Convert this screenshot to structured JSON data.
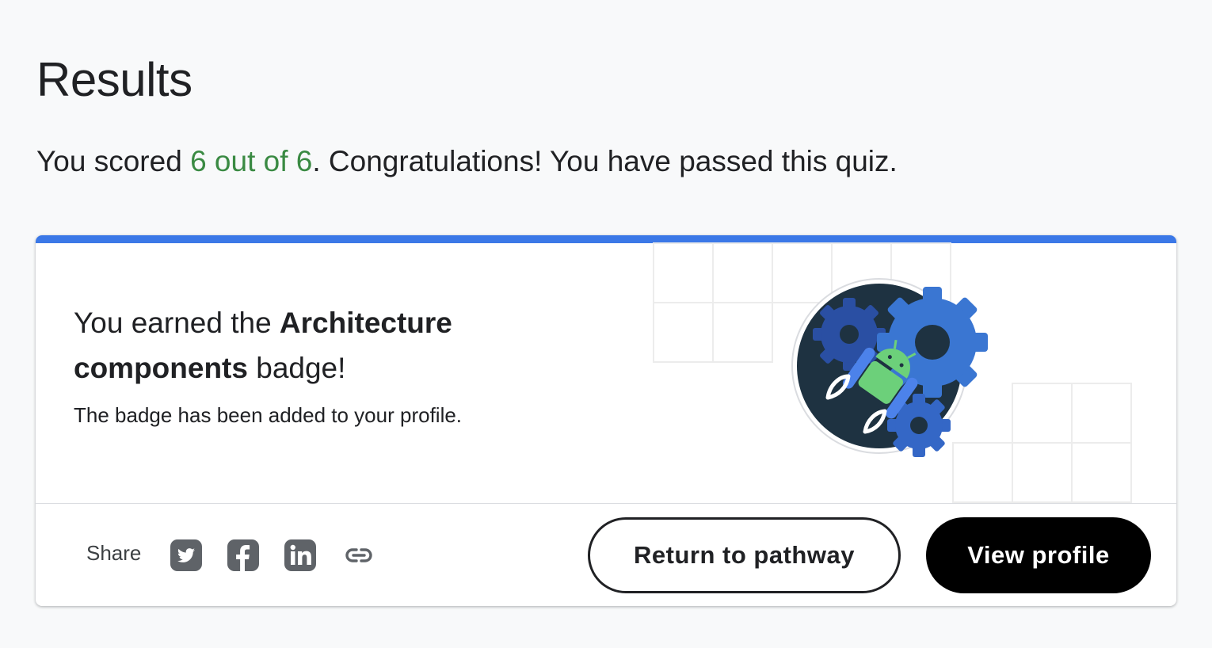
{
  "page": {
    "title": "Results",
    "score_prefix": "You scored ",
    "score_value": "6 out of 6",
    "score_suffix": ". Congratulations! You have passed this quiz."
  },
  "badge_card": {
    "heading_prefix": "You earned the ",
    "badge_name_line1": "Architecture",
    "badge_name_line2": "components",
    "heading_suffix": " badge!",
    "subtext": "The badge has been added to your profile.",
    "badge_icon": "architecture-components-badge"
  },
  "share": {
    "label": "Share",
    "icons": [
      "twitter-icon",
      "facebook-icon",
      "linkedin-icon",
      "link-icon"
    ]
  },
  "actions": {
    "return_label": "Return to pathway",
    "view_profile_label": "View profile"
  },
  "colors": {
    "background": "#f8f9fa",
    "accent_bar": "#3b78e7",
    "score_green": "#3a8a43",
    "primary_button": "#000000"
  }
}
